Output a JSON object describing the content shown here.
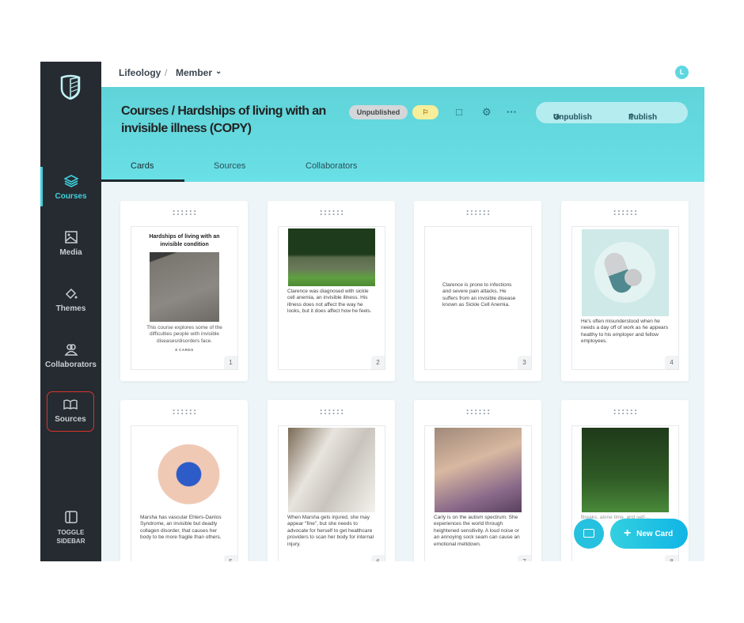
{
  "sidebar": {
    "items": [
      {
        "label": "Courses",
        "icon": "layers-icon"
      },
      {
        "label": "Media",
        "icon": "image-icon"
      },
      {
        "label": "Themes",
        "icon": "paint-bucket-icon"
      },
      {
        "label": "Collaborators",
        "icon": "users-icon"
      },
      {
        "label": "Sources",
        "icon": "book-icon"
      }
    ],
    "toggle_line1": "TOGGLE",
    "toggle_line2": "SIDEBAR"
  },
  "topbar": {
    "org": "Lifeology",
    "separator": "/",
    "role": "Member",
    "avatar": "L"
  },
  "header": {
    "title": "Courses / Hardships of living with an invisible illness (COPY)",
    "status": "Unpublished",
    "unpublish": "Unpublish",
    "publish": "Publish"
  },
  "tabs": [
    "Cards",
    "Sources",
    "Collaborators"
  ],
  "cards": [
    {
      "num": "1",
      "title": "Hardships of living with an invisible condition",
      "text": "This course explores some of the difficulties people with invisible diseases/disorders face.",
      "meta": "8 CARDS"
    },
    {
      "num": "2",
      "text": "Clarence was diagnosed with sickle cell anemia, an invisible illness. His illness does not affect the way he looks, but it does affect how he feels."
    },
    {
      "num": "3",
      "text": "Clarence is prone to infections and severe pain attacks. He suffers from an invisible disease known as Sickle Cell Anemia."
    },
    {
      "num": "4",
      "text": "He's often misunderstood when he needs a day off of work as he appears healthy to his employer and fellow employees."
    },
    {
      "num": "5",
      "text": "Marsha has vascular Ehlers-Danlos Syndrome, an invisible but deadly collagen disorder, that causes her body to be more fragile than others."
    },
    {
      "num": "6",
      "text": "When Marsha gets injured, she may appear \"fine\", but she needs to advocate for herself to get healthcare providers to scan her body for internal injury."
    },
    {
      "num": "7",
      "text": "Carly is on the autism spectrum. She experiences the world through heightened sensitivity. A loud noise or an annoying sock seam can cause an emotional meltdown."
    },
    {
      "num": "8",
      "text": "Breaks, alone time, and self-..."
    }
  ],
  "fab": {
    "new_card": "New Card"
  },
  "colors": {
    "accent": "#3fd2dd",
    "header": "#66dde3",
    "sidebar": "#262b31"
  }
}
